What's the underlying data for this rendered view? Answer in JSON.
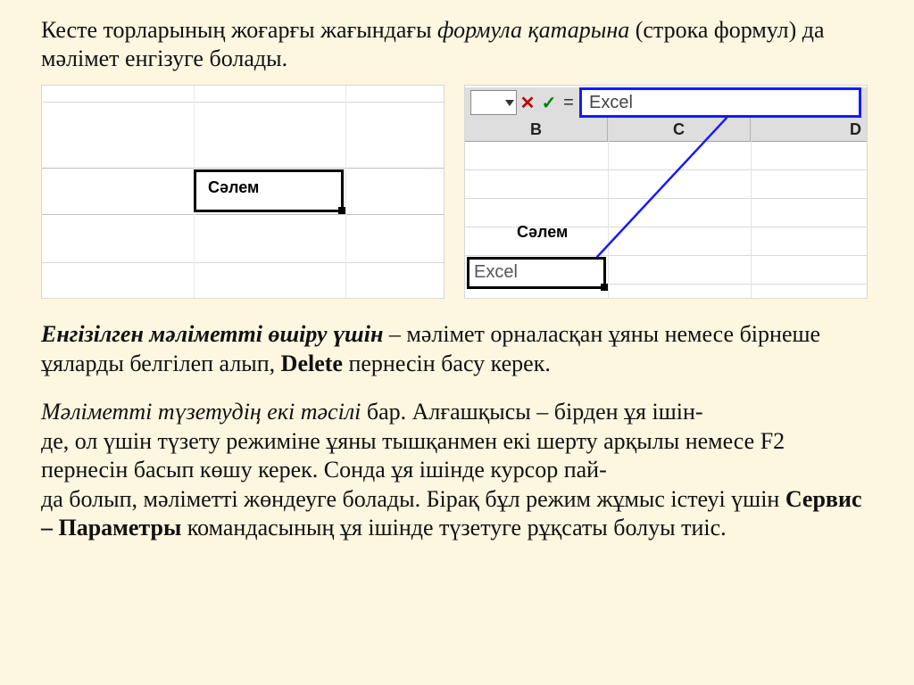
{
  "intro": {
    "t1": "Кесте торларының жоғарғы жағындағы ",
    "t2_italic": "формула қатарына",
    "t3": " (строка формул) да мәлімет енгізуге болады."
  },
  "fig_left": {
    "cell_label": "Сәлем"
  },
  "fig_right": {
    "formula_bar_value": "Excel",
    "col_b": "B",
    "col_c": "C",
    "col_d": "D",
    "overlay_label": "Сәлем",
    "cell_value": "Excel"
  },
  "p2": {
    "a_bi": "Енгізілген мәліметті өшіру үшін",
    "b": " – мәлімет орналасқан ұяны немесе бірнеше ұяларды белгілеп алып, ",
    "c_b": "Delete",
    "d": " пернесін басу керек."
  },
  "p3": {
    "a_i": "Мәліметті түзетудің екі тәсілі",
    "b": " бар. Алғашқысы – бірден ұя ішін-",
    "c": "де, ол үшін түзету режиміне ұяны тышқанмен екі шерту арқылы немесе F2 пернесін басып көшу керек. Сонда ұя ішінде курсор пай-",
    "d": "да болып, мәліметті жөндеуге болады. Бірақ бұл режим жұмыс істеуі үшін ",
    "e_b": "Сервис – Параметры",
    "f": " командасының ұя ішінде түзетуге рұқсаты болуы тиіс."
  }
}
